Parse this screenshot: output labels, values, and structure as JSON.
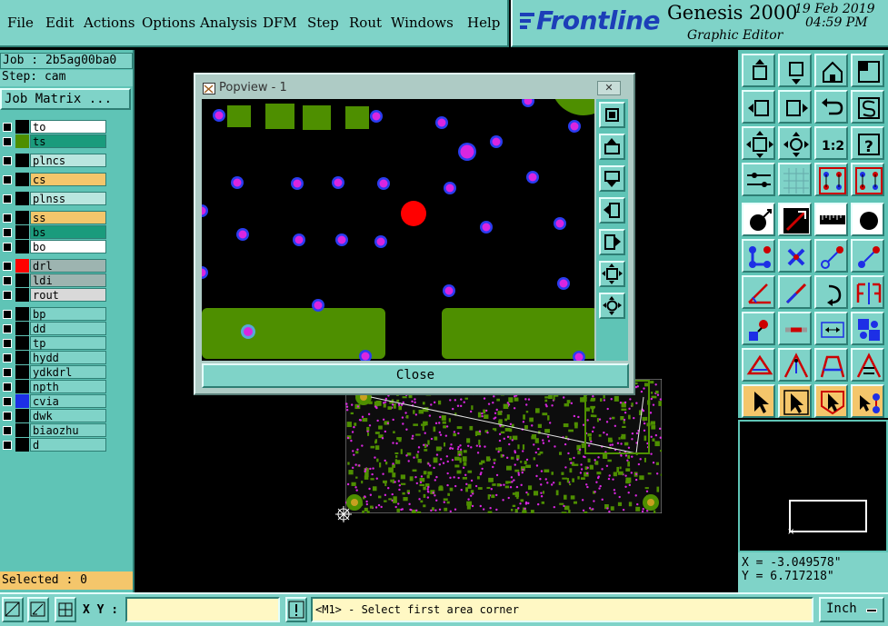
{
  "menu": {
    "file": "File",
    "edit": "Edit",
    "actions": "Actions",
    "options": "Options",
    "analysis": "Analysis",
    "dfm": "DFM",
    "step": "Step",
    "rout": "Rout",
    "windows": "Windows",
    "help": "Help"
  },
  "brand": {
    "logo": "Frontline",
    "product": "Genesis 2000",
    "subtitle": "Graphic Editor",
    "date": "19 Feb 2019",
    "time": "04:59 PM"
  },
  "left": {
    "job": "Job : 2b5ag00ba0",
    "step": "Step: cam",
    "job_matrix": "Job Matrix ...",
    "layers": [
      {
        "name": "to",
        "bg": "#ffffff",
        "swatch": "#000000",
        "mark": "✎"
      },
      {
        "name": "ts",
        "bg": "#1a9b7c",
        "swatch": "#4e8f00",
        "mark": "✎"
      },
      {
        "name": "plncs",
        "bg": "#b9e6df",
        "swatch": "#000000",
        "mark": ""
      },
      {
        "name": "cs",
        "bg": "#f4c66b",
        "swatch": "#000000",
        "mark": "✎"
      },
      {
        "name": "plnss",
        "bg": "#b9e6df",
        "swatch": "#000000",
        "mark": ""
      },
      {
        "name": "ss",
        "bg": "#f4c66b",
        "swatch": "#000000",
        "mark": "✎"
      },
      {
        "name": "bs",
        "bg": "#1a9b7c",
        "swatch": "#000000",
        "mark": ""
      },
      {
        "name": "bo",
        "bg": "#ffffff",
        "swatch": "#000000",
        "mark": ""
      },
      {
        "name": "drl",
        "bg": "#9db4b0",
        "swatch": "#ff0000",
        "mark": "⊞"
      },
      {
        "name": "ldi",
        "bg": "#9db4b0",
        "swatch": "#000000",
        "mark": ""
      },
      {
        "name": "rout",
        "bg": "#d9d9d9",
        "swatch": "#000000",
        "mark": ""
      },
      {
        "name": "bp",
        "bg": "#7fd3c8",
        "swatch": "#000000",
        "mark": ""
      },
      {
        "name": "dd",
        "bg": "#7fd3c8",
        "swatch": "#000000",
        "mark": ""
      },
      {
        "name": "tp",
        "bg": "#7fd3c8",
        "swatch": "#000000",
        "mark": "✎"
      },
      {
        "name": "hydd",
        "bg": "#7fd3c8",
        "swatch": "#000000",
        "mark": ""
      },
      {
        "name": "ydkdrl",
        "bg": "#7fd3c8",
        "swatch": "#000000",
        "mark": ""
      },
      {
        "name": "npth",
        "bg": "#7fd3c8",
        "swatch": "#000000",
        "mark": ""
      },
      {
        "name": "cvia",
        "bg": "#7fd3c8",
        "swatch": "#1d2fe6",
        "mark": ""
      },
      {
        "name": "dwk",
        "bg": "#7fd3c8",
        "swatch": "#000000",
        "mark": ""
      },
      {
        "name": "biaozhu",
        "bg": "#7fd3c8",
        "swatch": "#000000",
        "mark": ""
      },
      {
        "name": "d",
        "bg": "#7fd3c8",
        "swatch": "#000000",
        "mark": ""
      }
    ],
    "selected": "Selected : 0"
  },
  "popview": {
    "title": "Popview - 1",
    "close_x": "✕",
    "close_label": "Close"
  },
  "coords": {
    "x": "X = -3.049578\"",
    "y": "Y = 6.717218\""
  },
  "bottom": {
    "xy_label": "X Y :",
    "xy_value": "",
    "message": "<M1> - Select first area corner",
    "units": "Inch"
  },
  "colors": {
    "panel": "#7fd3c8",
    "panel_dark": "#5fc4b6",
    "accent_orange": "#f4c66b",
    "pad_green": "#4e8f00",
    "via_magenta": "#d926e0",
    "via_blue": "#2a3cf0",
    "highlight_red": "#ff0000"
  }
}
